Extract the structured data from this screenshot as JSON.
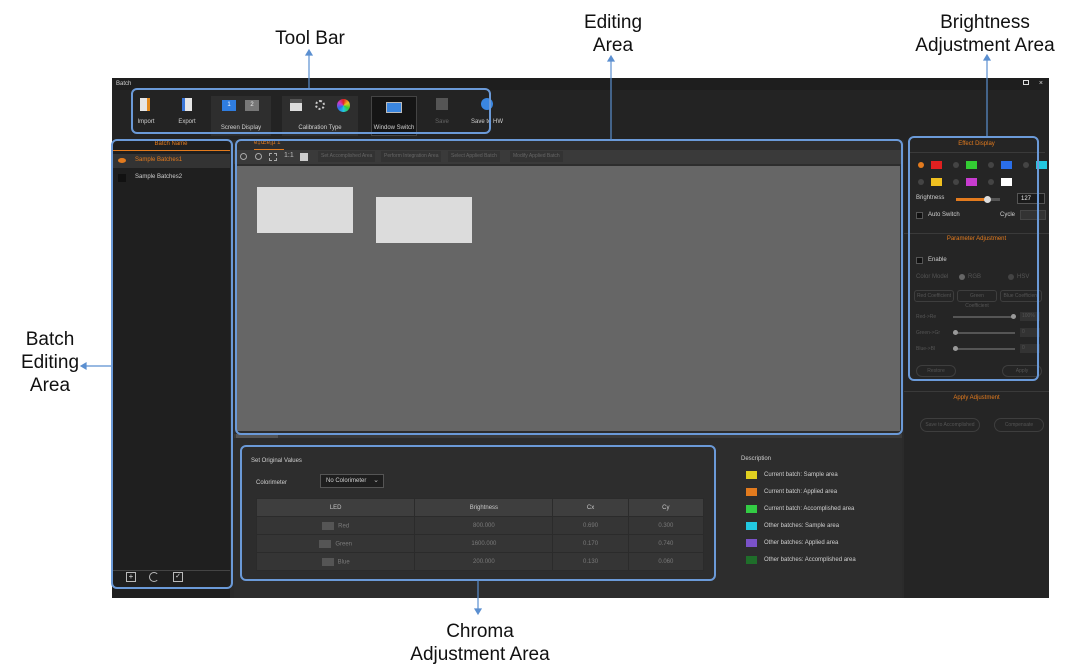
{
  "callouts": {
    "toolbar": "Tool Bar",
    "editing_1": "Editing",
    "editing_2": "Area",
    "brightness_1": "Brightness",
    "brightness_2": "Adjustment Area",
    "batch_1": "Batch",
    "batch_2": "Editing",
    "batch_3": "Area",
    "chroma_1": "Chroma",
    "chroma_2": "Adjustment Area"
  },
  "window": {
    "title": "Batch",
    "restore_icon": "restore-icon",
    "close_glyph": "×"
  },
  "toolbar": {
    "import": "Import",
    "export": "Export",
    "screen_display": "Screen Display",
    "calibration_type": "Calibration Type",
    "window_switch": "Window Switch",
    "save": "Save",
    "save_to_hw": "Save to HW"
  },
  "left": {
    "header": "Batch Name",
    "items": [
      "Sample Batches1",
      "Sample Batches2"
    ]
  },
  "editing": {
    "tab": "é‡Œé¡µ 1",
    "tool_tabs": [
      "Set Accomplished Area",
      "Perform Integration Area",
      "Select Applied Batch",
      "Modify Applied Batch"
    ]
  },
  "right": {
    "effect_header": "Effect Display",
    "brightness_label": "Brightness",
    "brightness_value": "127",
    "auto_switch": "Auto Switch",
    "cycle": "Cycle",
    "param_header": "Parameter Adjustment",
    "enable": "Enable",
    "color_model": "Color Model",
    "rgb": "RGB",
    "hsv": "HSV",
    "coef_buttons": [
      "Red Coefficient",
      "Green Coefficient",
      "Blue Coefficient"
    ],
    "sliders": [
      "Red->Re",
      "Green->Gr",
      "Blue->Bl"
    ],
    "slider_values": [
      "100%",
      "0",
      "0"
    ],
    "reset": "Restore",
    "apply": "Apply",
    "apply_header": "Apply Adjustment",
    "apply_buttons": [
      "Save to Accomplished",
      "Compensate"
    ]
  },
  "chroma": {
    "set_original": "Set Original Values",
    "colorimeter_label": "Colorimeter",
    "colorimeter_value": "No Colorimeter",
    "headers": [
      "LED",
      "Brightness",
      "Cx",
      "Cy"
    ],
    "rows": [
      [
        "Red",
        "800.000",
        "0.690",
        "0.300"
      ],
      [
        "Green",
        "1600.000",
        "0.170",
        "0.740"
      ],
      [
        "Blue",
        "200.000",
        "0.130",
        "0.060"
      ]
    ]
  },
  "description": {
    "title": "Description",
    "items": [
      {
        "label": "Current batch: Sample area",
        "color": "#e0d020"
      },
      {
        "label": "Current batch: Applied area",
        "color": "#e37b1e"
      },
      {
        "label": "Current batch: Accomplished area",
        "color": "#33cc44"
      },
      {
        "label": "Other batches: Sample area",
        "color": "#22c8e0"
      },
      {
        "label": "Other batches: Applied area",
        "color": "#7a52c8"
      },
      {
        "label": "Other batches: Accomplished area",
        "color": "#1f6e2a"
      }
    ]
  },
  "colors": {
    "accent": "#e37b1e",
    "callout_box": "#6b9ad8",
    "effect_swatches": [
      "#e02020",
      "#33cc33",
      "#2a6ee8",
      "#22c8e0",
      "#f0c020",
      "#c83cd0",
      "#ffffff"
    ]
  }
}
